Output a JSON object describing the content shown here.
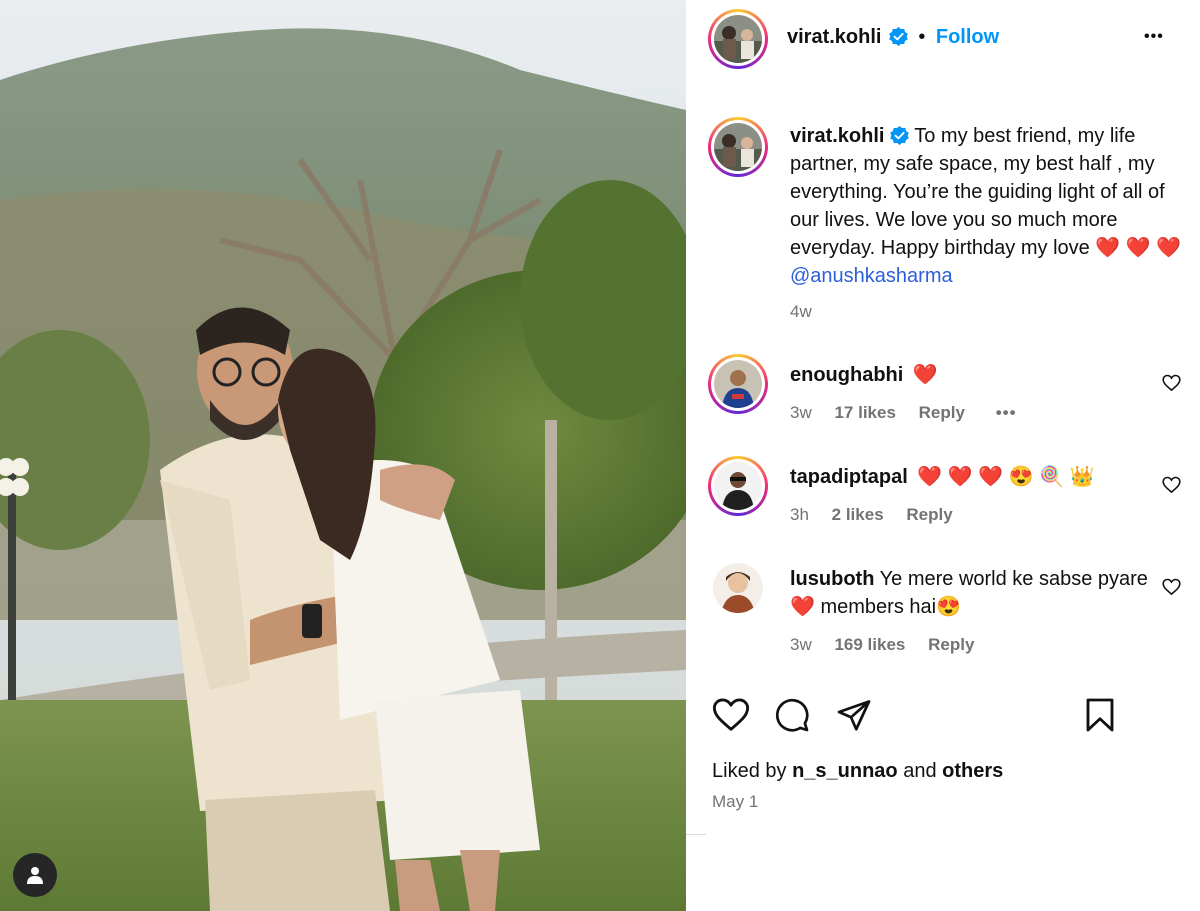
{
  "post": {
    "author": "virat.kohli",
    "follow_label": "Follow",
    "separator": "•",
    "more_label": "•••",
    "caption_text": "To my best friend, my life partner, my safe space, my best half , my everything. You’re the guiding light of all of our lives. We love you so much more everyday. Happy birthday my love",
    "caption_hearts": "❤️ ❤️",
    "caption_heart_end": "❤️",
    "caption_mention": "@anushkasharma",
    "caption_age": "4w",
    "liked_prefix": "Liked by",
    "liked_user": "n_s_unnao",
    "liked_and": "and",
    "liked_others": "others",
    "date": "May 1"
  },
  "comments": [
    {
      "user": "enoughabhi",
      "text": "❤️",
      "age": "3w",
      "likes": "17 likes",
      "reply": "Reply",
      "more": "•••"
    },
    {
      "user": "tapadiptapal",
      "text": "❤️ ❤️ ❤️ 😍 🍭 👑",
      "age": "3h",
      "likes": "2 likes",
      "reply": "Reply"
    },
    {
      "user": "lusuboth",
      "text_a": "Ye mere world ke sabse pyare",
      "heart": "❤️",
      "text_b": "members hai",
      "emoji": "😍",
      "age": "3w",
      "likes": "169 likes",
      "reply": "Reply"
    }
  ],
  "icons": {
    "like": "heart-outline-icon",
    "comment": "comment-bubble-icon",
    "share": "paper-plane-icon",
    "save": "bookmark-icon",
    "verified": "verified-badge-icon",
    "tag": "user-tag-icon"
  },
  "colors": {
    "accent": "#0095f6",
    "verified": "#0095f6",
    "mention": "#2c5fd8",
    "muted": "#737373",
    "heart": "#e0222f"
  }
}
